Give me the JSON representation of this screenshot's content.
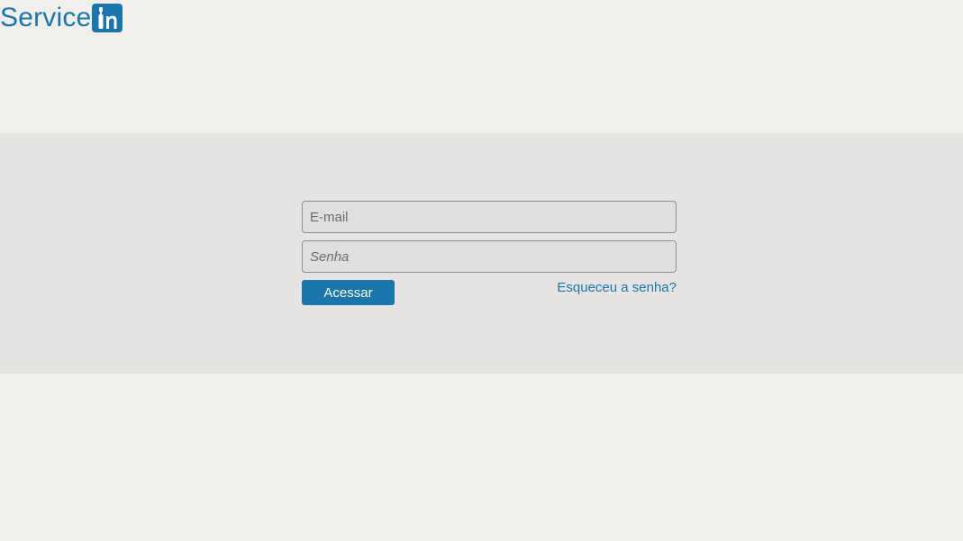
{
  "header": {
    "logo_text": "Service",
    "logo_badge_text": "in"
  },
  "login": {
    "email_placeholder": "E-mail",
    "password_placeholder": "Senha",
    "submit_label": "Acessar",
    "forgot_link": "Esqueceu a senha?"
  },
  "colors": {
    "brand": "#1a76ab",
    "background": "#f0efec",
    "band": "#e5e4e2"
  },
  "icons": {
    "logo_badge": "tool-in-icon"
  }
}
